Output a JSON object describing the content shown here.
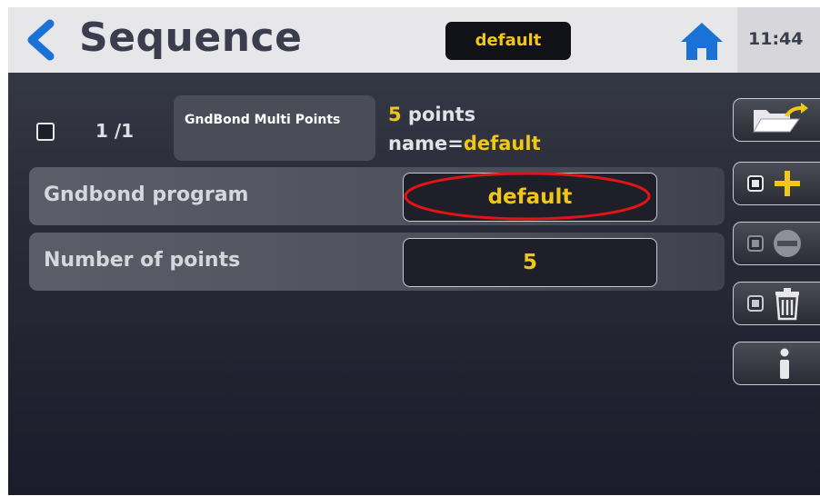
{
  "header": {
    "title": "Sequence",
    "badge": "default",
    "clock": "11:44",
    "icons": [
      "chevron-left-icon",
      "home-icon"
    ]
  },
  "test": {
    "step_count": "1 /1",
    "type_label": "GndBond Multi Points",
    "points_num": "5",
    "points_text": " points",
    "name_prefix": "name=",
    "name_value": "default"
  },
  "params": [
    {
      "label": "Gndbond program",
      "value": "default"
    },
    {
      "label": "Number of points",
      "value": "5"
    }
  ],
  "side_buttons": [
    {
      "icon": "folder-open-icon"
    },
    {
      "icon": "add-icon"
    },
    {
      "icon": "remove-icon"
    },
    {
      "icon": "trash-icon"
    },
    {
      "icon": "info-icon"
    }
  ],
  "colors": {
    "accent_yellow": "#f2c618",
    "chevron_blue": "#1a72d6",
    "highlight_red": "#e01616"
  }
}
